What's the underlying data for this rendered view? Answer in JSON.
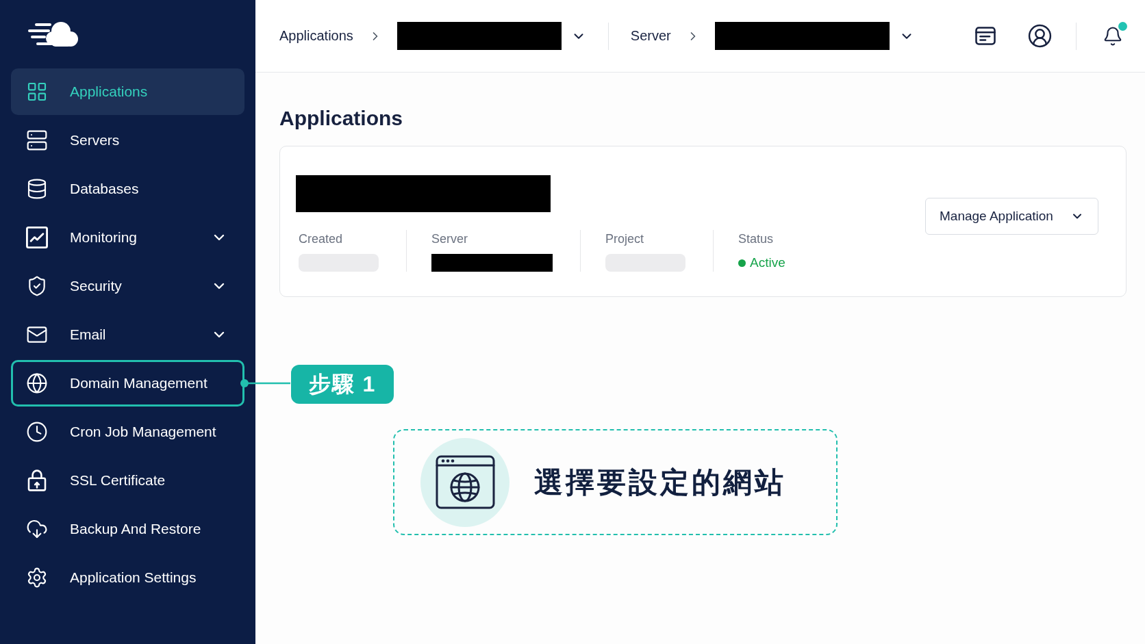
{
  "sidebar": {
    "items": [
      {
        "label": "Applications",
        "selected": true,
        "highlighted": false,
        "expandable": false
      },
      {
        "label": "Servers",
        "selected": false,
        "highlighted": false,
        "expandable": false
      },
      {
        "label": "Databases",
        "selected": false,
        "highlighted": false,
        "expandable": false
      },
      {
        "label": "Monitoring",
        "selected": false,
        "highlighted": false,
        "expandable": true
      },
      {
        "label": "Security",
        "selected": false,
        "highlighted": false,
        "expandable": true
      },
      {
        "label": "Email",
        "selected": false,
        "highlighted": false,
        "expandable": true
      },
      {
        "label": "Domain Management",
        "selected": false,
        "highlighted": true,
        "expandable": false
      },
      {
        "label": "Cron Job Management",
        "selected": false,
        "highlighted": false,
        "expandable": false
      },
      {
        "label": "SSL Certificate",
        "selected": false,
        "highlighted": false,
        "expandable": false
      },
      {
        "label": "Backup And Restore",
        "selected": false,
        "highlighted": false,
        "expandable": false
      },
      {
        "label": "Application Settings",
        "selected": false,
        "highlighted": false,
        "expandable": false
      }
    ]
  },
  "top_bar": {
    "breadcrumbs": [
      {
        "label": "Applications"
      },
      {
        "label": "Server"
      }
    ],
    "notification_unread": true
  },
  "page_title": "Applications",
  "application_card": {
    "fields": [
      {
        "label": "Created",
        "kind": "skeleton"
      },
      {
        "label": "Server",
        "kind": "redacted"
      },
      {
        "label": "Project",
        "kind": "skeleton"
      },
      {
        "label": "Status",
        "kind": "status",
        "value": "Active",
        "color": "#16a34a"
      }
    ],
    "manage_button": "Manage Application"
  },
  "tutorial": {
    "step_badge": "步驟 1",
    "instruction": "選擇要設定的網站"
  }
}
